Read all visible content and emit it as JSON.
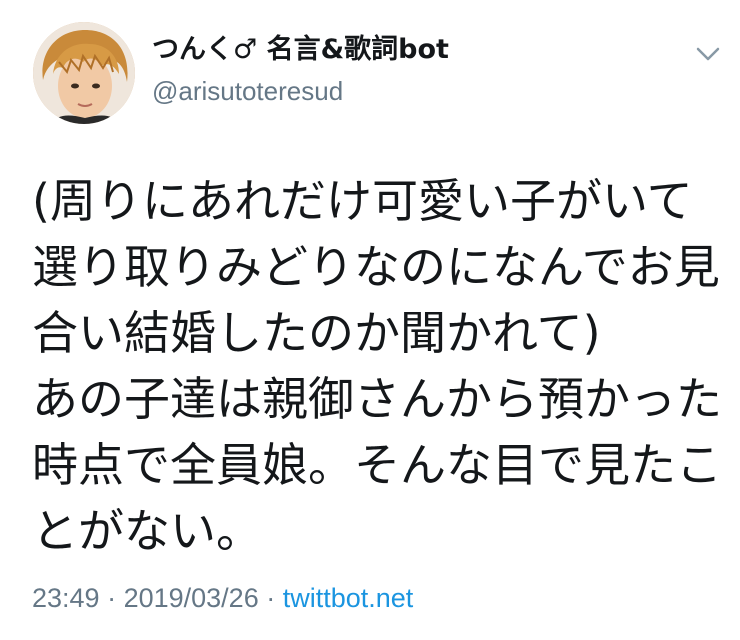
{
  "user": {
    "display_name": "つんく♂ 名言&歌詞bot",
    "handle": "@arisutoteresud"
  },
  "icons": {
    "menu": "chevron-down-icon",
    "avatar": "profile-photo"
  },
  "tweet": {
    "text": "(周りにあれだけ可愛い子がいて選り取りみどりなのになんでお見合い結婚したのか聞かれて)\nあの子達は親御さんから預かった時点で全員娘。そんな目で見たことがない。"
  },
  "meta": {
    "time": "23:49",
    "separator1": " · ",
    "date": "2019/03/26",
    "separator2": " · ",
    "source": "twittbot.net"
  },
  "colors": {
    "text": "#14171a",
    "secondary": "#657786",
    "link": "#1b95e0"
  }
}
